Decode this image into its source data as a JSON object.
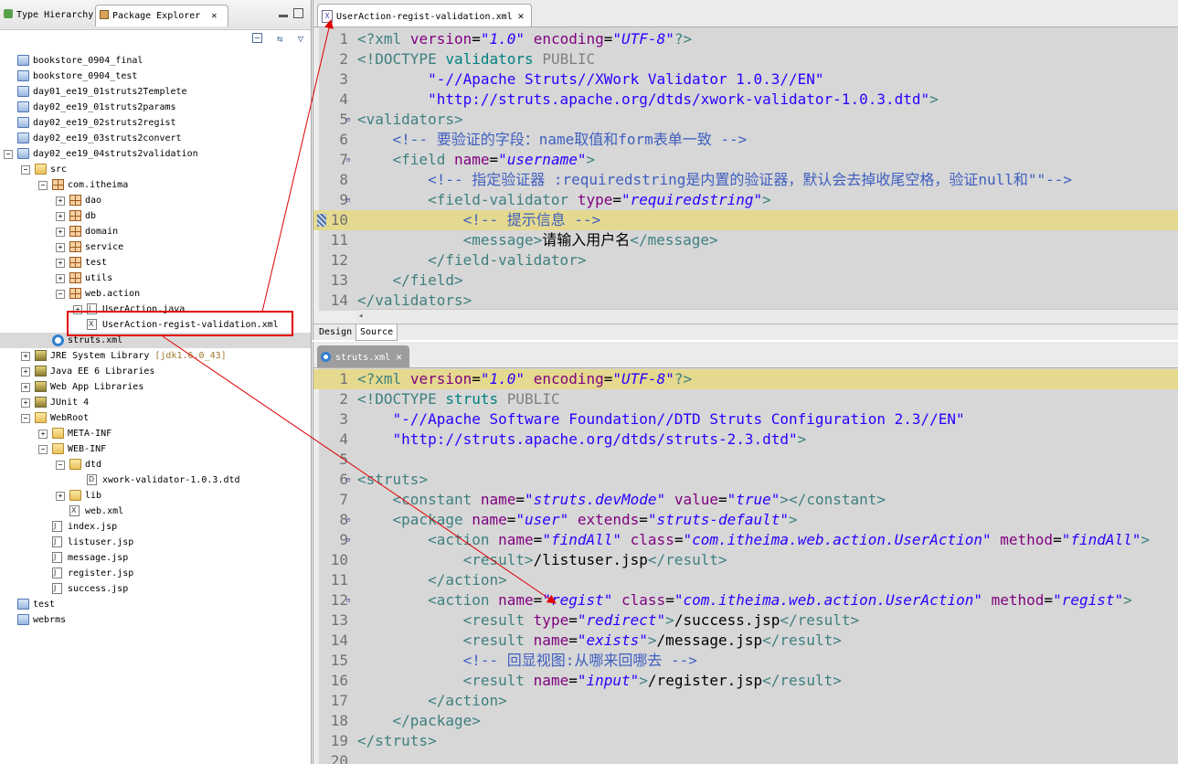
{
  "explorer": {
    "tabs": [
      {
        "label": "Type Hierarchy"
      },
      {
        "label": "Package Explorer"
      }
    ],
    "tree": [
      {
        "label": "bookstore_0904_final",
        "icon": "project-icon"
      },
      {
        "label": "bookstore_0904_test",
        "icon": "project-icon"
      },
      {
        "label": "day01_ee19_01struts2Templete",
        "icon": "project-icon"
      },
      {
        "label": "day02_ee19_01struts2params",
        "icon": "project-icon"
      },
      {
        "label": "day02_ee19_02struts2regist",
        "icon": "project-icon"
      },
      {
        "label": "day02_ee19_03struts2convert",
        "icon": "project-icon"
      },
      {
        "label": "day02_ee19_04struts2validation",
        "icon": "project-icon"
      },
      {
        "label": "src",
        "icon": "source-folder-icon"
      },
      {
        "label": "com.itheima",
        "icon": "package-icon"
      },
      {
        "label": "dao",
        "icon": "package-icon"
      },
      {
        "label": "db",
        "icon": "package-icon"
      },
      {
        "label": "domain",
        "icon": "package-icon"
      },
      {
        "label": "service",
        "icon": "package-icon"
      },
      {
        "label": "test",
        "icon": "package-icon"
      },
      {
        "label": "utils",
        "icon": "package-icon"
      },
      {
        "label": "web.action",
        "icon": "package-icon"
      },
      {
        "label": "UserAction.java",
        "icon": "java-file-icon"
      },
      {
        "label": "UserAction-regist-validation.xml",
        "icon": "xml-file-icon"
      },
      {
        "label": "struts.xml",
        "icon": "struts-config-icon"
      },
      {
        "label": "JRE System Library",
        "icon": "library-icon",
        "decor": "[jdk1.6.0_43]"
      },
      {
        "label": "Java EE 6 Libraries",
        "icon": "library-icon"
      },
      {
        "label": "Web App Libraries",
        "icon": "library-icon"
      },
      {
        "label": "JUnit 4",
        "icon": "library-icon"
      },
      {
        "label": "WebRoot",
        "icon": "folder-icon"
      },
      {
        "label": "META-INF",
        "icon": "folder-icon"
      },
      {
        "label": "WEB-INF",
        "icon": "folder-icon"
      },
      {
        "label": "dtd",
        "icon": "folder-icon"
      },
      {
        "label": "xwork-validator-1.0.3.dtd",
        "icon": "dtd-file-icon"
      },
      {
        "label": "lib",
        "icon": "folder-icon"
      },
      {
        "label": "web.xml",
        "icon": "xml-file-icon"
      },
      {
        "label": "index.jsp",
        "icon": "jsp-file-icon"
      },
      {
        "label": "listuser.jsp",
        "icon": "jsp-file-icon"
      },
      {
        "label": "message.jsp",
        "icon": "jsp-file-icon"
      },
      {
        "label": "register.jsp",
        "icon": "jsp-file-icon"
      },
      {
        "label": "success.jsp",
        "icon": "jsp-file-icon"
      },
      {
        "label": "test",
        "icon": "project-icon"
      },
      {
        "label": "webrms",
        "icon": "project-icon"
      }
    ]
  },
  "editor_top": {
    "tab_label": "UserAction-regist-validation.xml",
    "bottom_tabs": [
      "Design",
      "Source"
    ],
    "lines": [
      {
        "n": "1",
        "text": "<?xml version=\"1.0\" encoding=\"UTF-8\"?>"
      },
      {
        "n": "2",
        "text": "<!DOCTYPE validators PUBLIC"
      },
      {
        "n": "3",
        "text": "        \"-//Apache Struts//XWork Validator 1.0.3//EN\""
      },
      {
        "n": "4",
        "text": "        \"http://struts.apache.org/dtds/xwork-validator-1.0.3.dtd\">"
      },
      {
        "n": "5",
        "text": "<validators>"
      },
      {
        "n": "6",
        "text": "    <!-- 要验证的字段：name取值和form表单一致 -->"
      },
      {
        "n": "7",
        "text": "    <field name=\"username\">"
      },
      {
        "n": "8",
        "text": "        <!-- 指定验证器 :requiredstring是内置的验证器，默认会去掉收尾空格，验证null和\"\"-->"
      },
      {
        "n": "9",
        "text": "        <field-validator type=\"requiredstring\">"
      },
      {
        "n": "10",
        "text": "            <!-- 提示信息 -->"
      },
      {
        "n": "11",
        "text": "            <message>请输入用户名</message>"
      },
      {
        "n": "12",
        "text": "        </field-validator>"
      },
      {
        "n": "13",
        "text": "    </field>"
      },
      {
        "n": "14",
        "text": "</validators>"
      }
    ]
  },
  "editor_bottom": {
    "tab_label": "struts.xml",
    "lines": [
      {
        "n": "1",
        "text": "<?xml version=\"1.0\" encoding=\"UTF-8\"?>"
      },
      {
        "n": "2",
        "text": "<!DOCTYPE struts PUBLIC"
      },
      {
        "n": "3",
        "text": "    \"-//Apache Software Foundation//DTD Struts Configuration 2.3//EN\""
      },
      {
        "n": "4",
        "text": "    \"http://struts.apache.org/dtds/struts-2.3.dtd\">"
      },
      {
        "n": "5",
        "text": ""
      },
      {
        "n": "6",
        "text": "<struts>"
      },
      {
        "n": "7",
        "text": "    <constant name=\"struts.devMode\" value=\"true\"></constant>"
      },
      {
        "n": "8",
        "text": "    <package name=\"user\" extends=\"struts-default\">"
      },
      {
        "n": "9",
        "text": "        <action name=\"findAll\" class=\"com.itheima.web.action.UserAction\" method=\"findAll\">"
      },
      {
        "n": "10",
        "text": "            <result>/listuser.jsp</result>"
      },
      {
        "n": "11",
        "text": "        </action>"
      },
      {
        "n": "12",
        "text": "        <action name=\"regist\" class=\"com.itheima.web.action.UserAction\" method=\"regist\">"
      },
      {
        "n": "13",
        "text": "            <result type=\"redirect\">/success.jsp</result>"
      },
      {
        "n": "14",
        "text": "            <result name=\"exists\">/message.jsp</result>"
      },
      {
        "n": "15",
        "text": "            <!-- 回显视图:从哪来回哪去 -->"
      },
      {
        "n": "16",
        "text": "            <result name=\"input\">/register.jsp</result>"
      },
      {
        "n": "17",
        "text": "        </action>"
      },
      {
        "n": "18",
        "text": "    </package>"
      },
      {
        "n": "19",
        "text": "</struts>"
      },
      {
        "n": "20",
        "text": ""
      }
    ]
  },
  "colors": {
    "code_bg": "#d7d7d7",
    "current_line": "#e4d98e",
    "annotation_red": "#e00000",
    "tag": "#3f7f7f",
    "attr_name": "#7f007f",
    "attr_value": "#2a00ff",
    "comment": "#3f5fbf"
  }
}
